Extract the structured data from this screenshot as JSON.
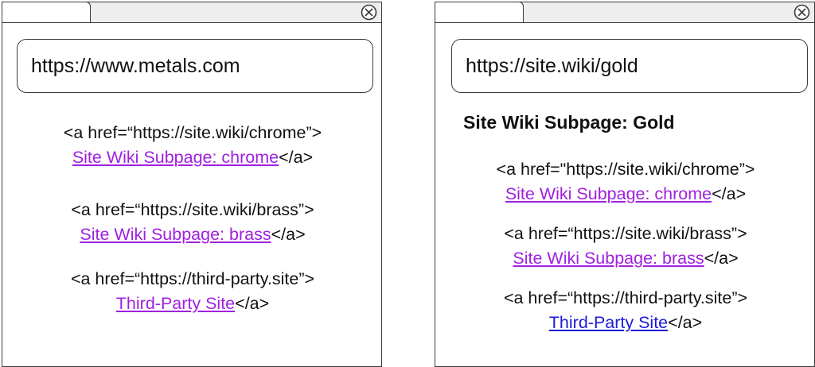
{
  "left_window": {
    "url": "https://www.metals.com",
    "links": [
      {
        "code": "<a href=“https://site.wiki/chrome”>",
        "text": "Site Wiki Subpage: chrome",
        "close": "</a>",
        "state": "visited"
      },
      {
        "code": "<a href=“https://site.wiki/brass”>",
        "text": "Site Wiki Subpage: brass",
        "close": "</a>",
        "state": "visited"
      },
      {
        "code": "<a href=“https://third-party.site”>",
        "text": "Third-Party Site",
        "close": "</a>",
        "state": "visited"
      }
    ]
  },
  "right_window": {
    "url": "https://site.wiki/gold",
    "heading": "Site Wiki Subpage: Gold",
    "links": [
      {
        "code": "<a href=\"https://site.wiki/chrome”>",
        "text": "Site Wiki Subpage: chrome",
        "close": "</a>",
        "state": "visited"
      },
      {
        "code": "<a href=“https://site.wiki/brass”>",
        "text": "Site Wiki Subpage: brass",
        "close": "</a>",
        "state": "visited"
      },
      {
        "code": "<a href=“https://third-party.site”>",
        "text": "Third-Party Site",
        "close": "</a>",
        "state": "unvisited"
      }
    ]
  },
  "colors": {
    "visited_link": "#a020e0",
    "unvisited_link": "#1a1ad8",
    "frame": "#3a3a3a"
  },
  "icons": {
    "close": "close-icon"
  }
}
